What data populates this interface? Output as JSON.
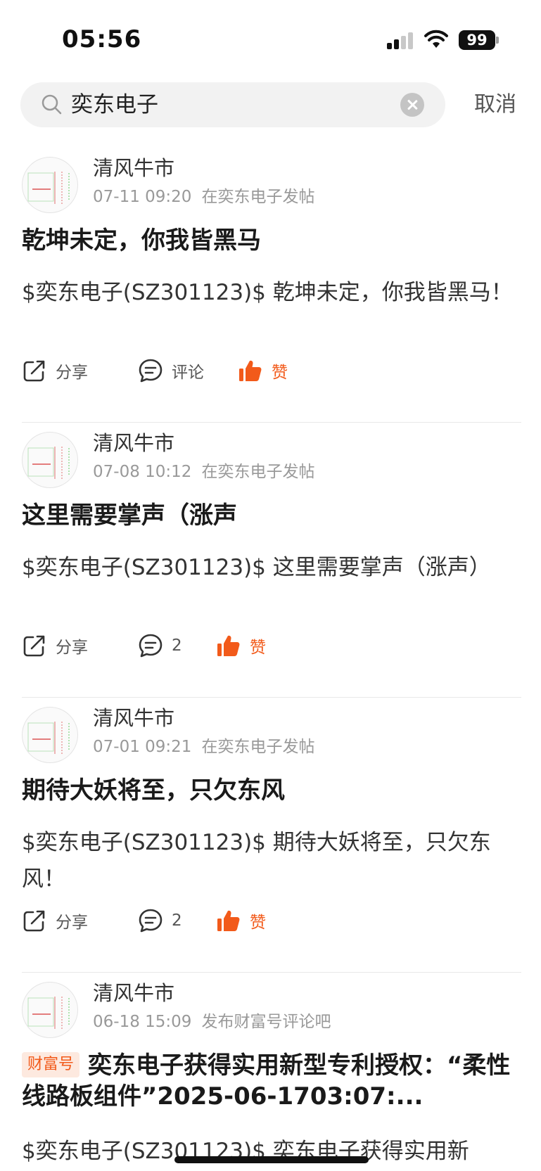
{
  "status_bar": {
    "time": "05:56",
    "battery": "99"
  },
  "search": {
    "query": "奕东电子",
    "cancel_label": "取消"
  },
  "posts": [
    {
      "author": "清风牛市",
      "timestamp": "07-11 09:20",
      "source": "在奕东电子发帖",
      "title": "乾坤未定，你我皆黑马",
      "body": "$奕东电子(SZ301123)$ 乾坤未定，你我皆黑马！",
      "share_label": "分享",
      "comment_label": "评论",
      "like_label": "赞"
    },
    {
      "author": "清风牛市",
      "timestamp": "07-08 10:12",
      "source": "在奕东电子发帖",
      "title": "这里需要掌声（涨声",
      "body": "$奕东电子(SZ301123)$ 这里需要掌声（涨声）",
      "share_label": "分享",
      "comment_label": "2",
      "like_label": "赞"
    },
    {
      "author": "清风牛市",
      "timestamp": "07-01 09:21",
      "source": "在奕东电子发帖",
      "title": "期待大妖将至，只欠东风",
      "body": "$奕东电子(SZ301123)$ 期待大妖将至，只欠东风！",
      "share_label": "分享",
      "comment_label": "2",
      "like_label": "赞"
    },
    {
      "author": "清风牛市",
      "timestamp": "06-18 15:09",
      "source": "发布财富号评论吧",
      "badge": "财富号",
      "title": "奕东电子获得实用新型专利授权：“柔性线路板组件”2025-06-1703:07:...",
      "body": "$奕东电子(SZ301123)$ 奕东电子获得实用新"
    }
  ],
  "colors": {
    "accent": "#f25a1a",
    "meta": "#999999",
    "divider": "#e8e8e8"
  },
  "icons": [
    "search-icon",
    "clear-icon",
    "share-icon",
    "comment-icon",
    "thumbs-up-icon"
  ]
}
